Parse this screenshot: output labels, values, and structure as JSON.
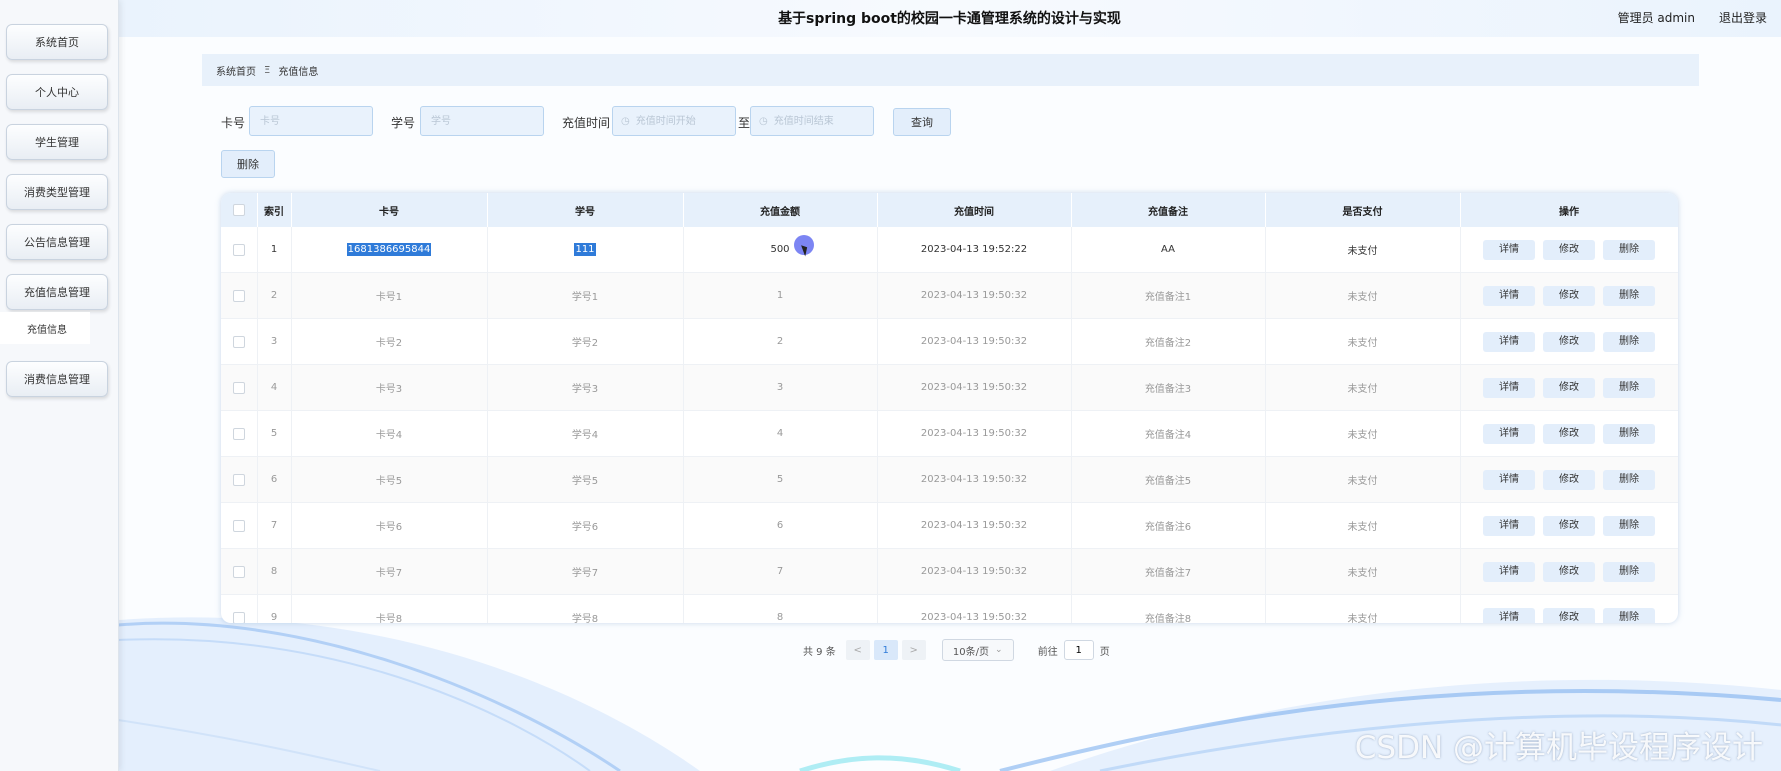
{
  "header": {
    "title": "基于spring boot的校园一卡通管理系统的设计与实现",
    "user": "管理员 admin",
    "logout": "退出登录"
  },
  "sidebar": {
    "items": [
      "系统首页",
      "个人中心",
      "学生管理",
      "消费类型管理",
      "公告信息管理",
      "充值信息管理",
      "消费信息管理"
    ],
    "sub_item": "充值信息"
  },
  "breadcrumb": {
    "home": "系统首页",
    "separator": "Ξ",
    "current": "充值信息"
  },
  "search": {
    "card_label": "卡号",
    "card_placeholder": "卡号",
    "student_label": "学号",
    "student_placeholder": "学号",
    "time_label": "充值时间",
    "start_placeholder": "充值时间开始",
    "to_label": "至",
    "end_placeholder": "充值时间结束",
    "query_button": "查询",
    "delete_button": "删除"
  },
  "table": {
    "headers": [
      "索引",
      "卡号",
      "学号",
      "充值金额",
      "充值时间",
      "充值备注",
      "是否支付",
      "操作"
    ],
    "actions": {
      "detail": "详情",
      "edit": "修改",
      "delete": "删除"
    },
    "rows": [
      {
        "index": "1",
        "card": "1681386695844",
        "student": "111",
        "amount": "500",
        "time": "2023-04-13 19:52:22",
        "note": "AA",
        "paid": "未支付"
      },
      {
        "index": "2",
        "card": "卡号1",
        "student": "学号1",
        "amount": "1",
        "time": "2023-04-13 19:50:32",
        "note": "充值备注1",
        "paid": "未支付"
      },
      {
        "index": "3",
        "card": "卡号2",
        "student": "学号2",
        "amount": "2",
        "time": "2023-04-13 19:50:32",
        "note": "充值备注2",
        "paid": "未支付"
      },
      {
        "index": "4",
        "card": "卡号3",
        "student": "学号3",
        "amount": "3",
        "time": "2023-04-13 19:50:32",
        "note": "充值备注3",
        "paid": "未支付"
      },
      {
        "index": "5",
        "card": "卡号4",
        "student": "学号4",
        "amount": "4",
        "time": "2023-04-13 19:50:32",
        "note": "充值备注4",
        "paid": "未支付"
      },
      {
        "index": "6",
        "card": "卡号5",
        "student": "学号5",
        "amount": "5",
        "time": "2023-04-13 19:50:32",
        "note": "充值备注5",
        "paid": "未支付"
      },
      {
        "index": "7",
        "card": "卡号6",
        "student": "学号6",
        "amount": "6",
        "time": "2023-04-13 19:50:32",
        "note": "充值备注6",
        "paid": "未支付"
      },
      {
        "index": "8",
        "card": "卡号7",
        "student": "学号7",
        "amount": "7",
        "time": "2023-04-13 19:50:32",
        "note": "充值备注7",
        "paid": "未支付"
      },
      {
        "index": "9",
        "card": "卡号8",
        "student": "学号8",
        "amount": "8",
        "time": "2023-04-13 19:50:32",
        "note": "充值备注8",
        "paid": "未支付"
      }
    ]
  },
  "pagination": {
    "total": "共 9 条",
    "prev": "<",
    "page": "1",
    "next": ">",
    "page_size": "10条/页",
    "goto_label": "前往",
    "goto_value": "1",
    "goto_suffix": "页"
  },
  "watermark": "CSDN @计算机毕设程序设计",
  "icons": {
    "dropdown": "chevron-down-icon",
    "clock": "clock-icon",
    "cursor": "pointer-cursor-icon"
  },
  "colors": {
    "accent": "#2f7bd9",
    "header_bg": "#e6f0fb",
    "button_bg": "#e3eefb",
    "cursor": "#6e78f2"
  }
}
